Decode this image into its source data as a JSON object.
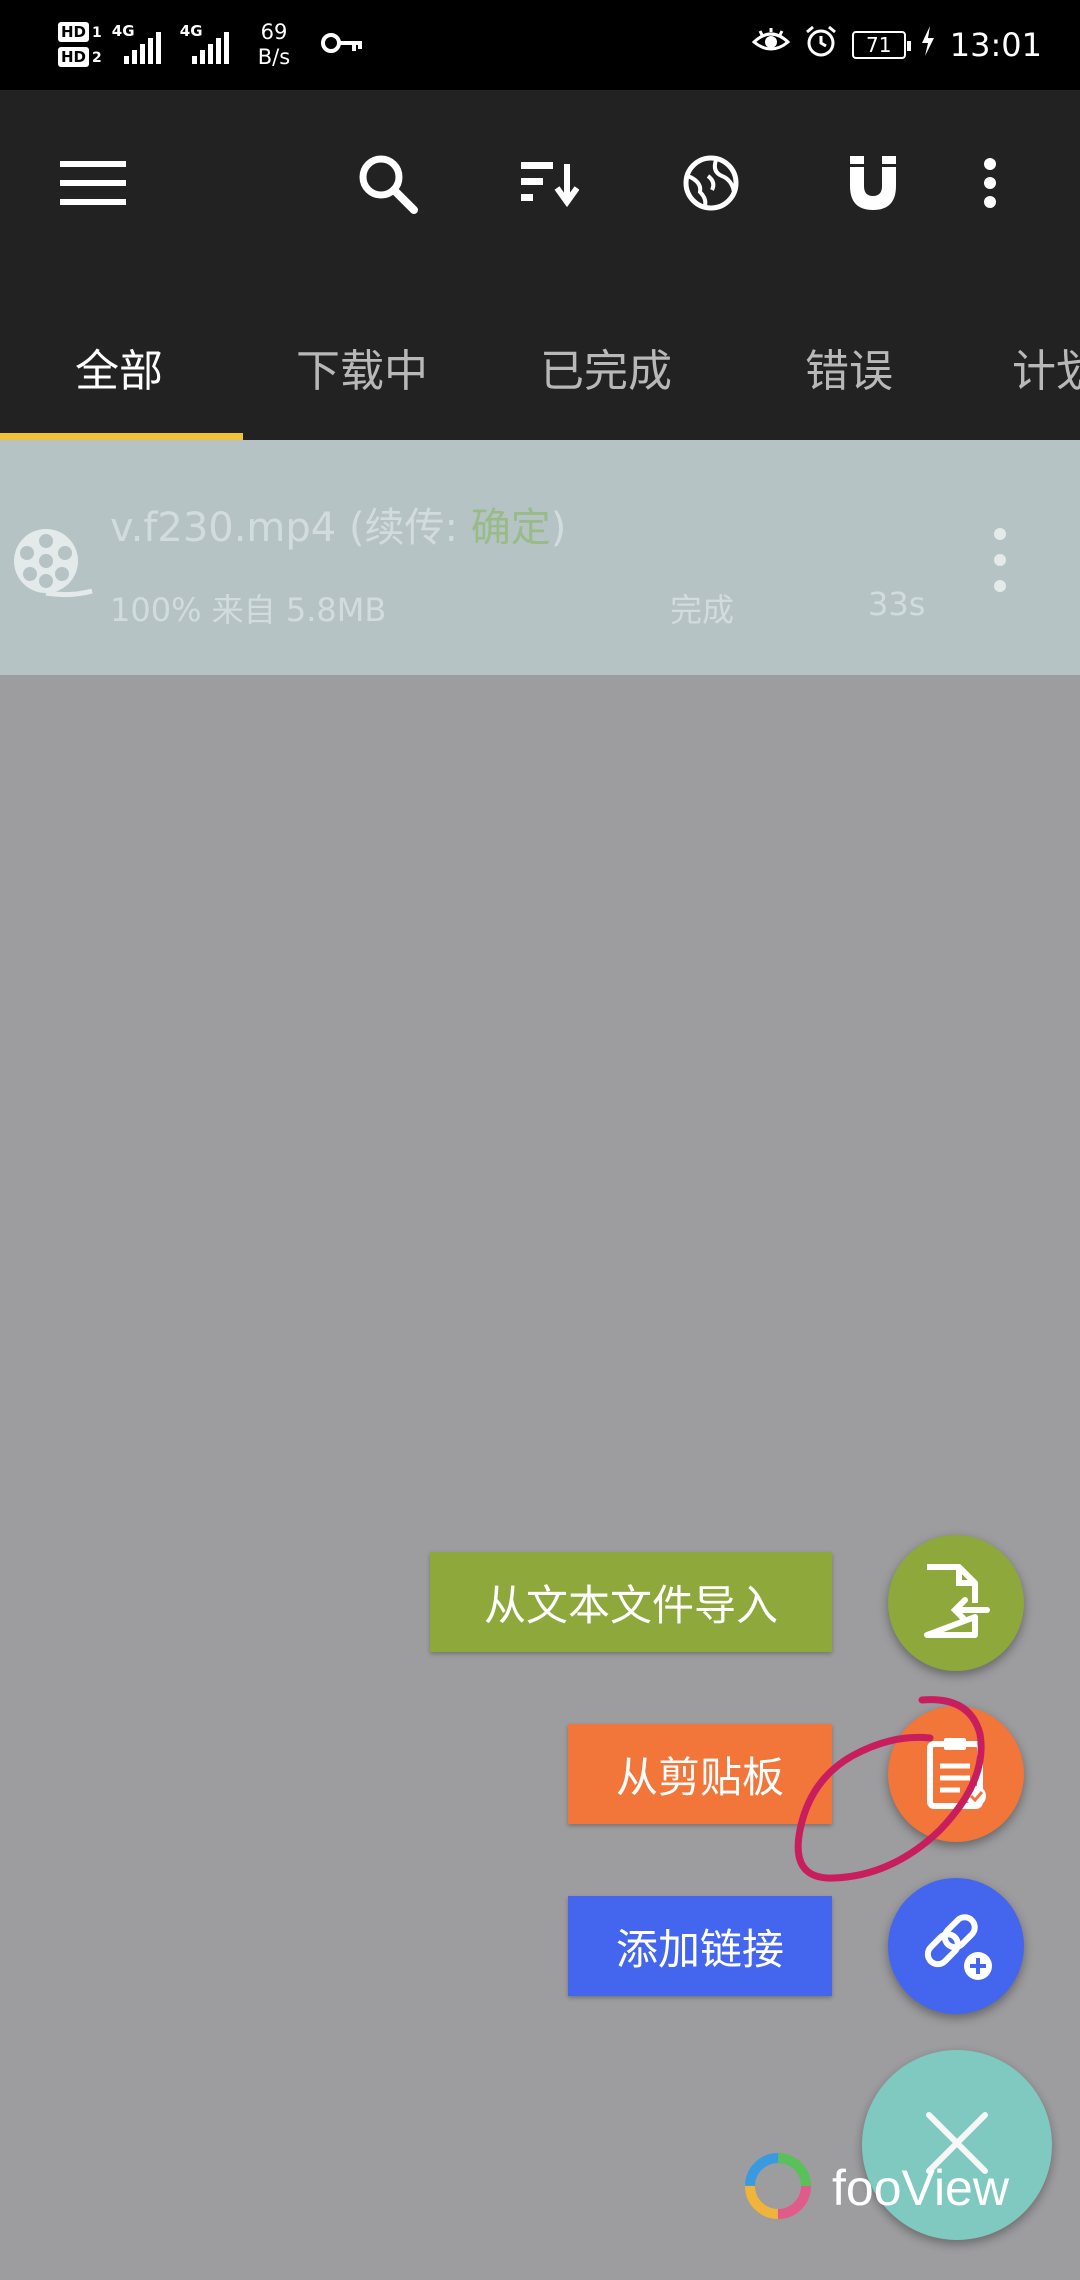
{
  "status_bar": {
    "sim1": "HD",
    "sim1_num": "1",
    "sim2": "HD",
    "sim2_num": "2",
    "net1": "4G",
    "net2": "4G",
    "speed_value": "69",
    "speed_unit": "B/s",
    "battery": "71",
    "time": "13:01"
  },
  "toolbar": {
    "icons": [
      "menu-icon",
      "search-icon",
      "sort-icon",
      "browser-globe-icon",
      "magnet-icon",
      "more-vert-icon"
    ]
  },
  "tabs": [
    {
      "label": "全部",
      "active": true
    },
    {
      "label": "下载中",
      "active": false
    },
    {
      "label": "已完成",
      "active": false
    },
    {
      "label": "错误",
      "active": false
    },
    {
      "label": "计划",
      "active": false
    }
  ],
  "download_item": {
    "filename": "v.f230.mp4",
    "resume_prefix": " (续传: ",
    "resume_value": "确定",
    "resume_suffix": ")",
    "progress": "100% 来自 5.8MB",
    "status": "完成",
    "elapsed": "33s"
  },
  "fab_menu": {
    "import_file": "从文本文件导入",
    "from_clipboard": "从剪贴板",
    "add_link": "添加链接"
  },
  "watermark": {
    "text": "fooView"
  },
  "colors": {
    "toolbar_bg": "#222222",
    "tab_indicator": "#f2c13b",
    "import_green": "#8ea83c",
    "clipboard_orange": "#f2753a",
    "link_blue": "#4466ee",
    "close_teal": "#7ecdc4",
    "annotation": "#c81e5e"
  }
}
